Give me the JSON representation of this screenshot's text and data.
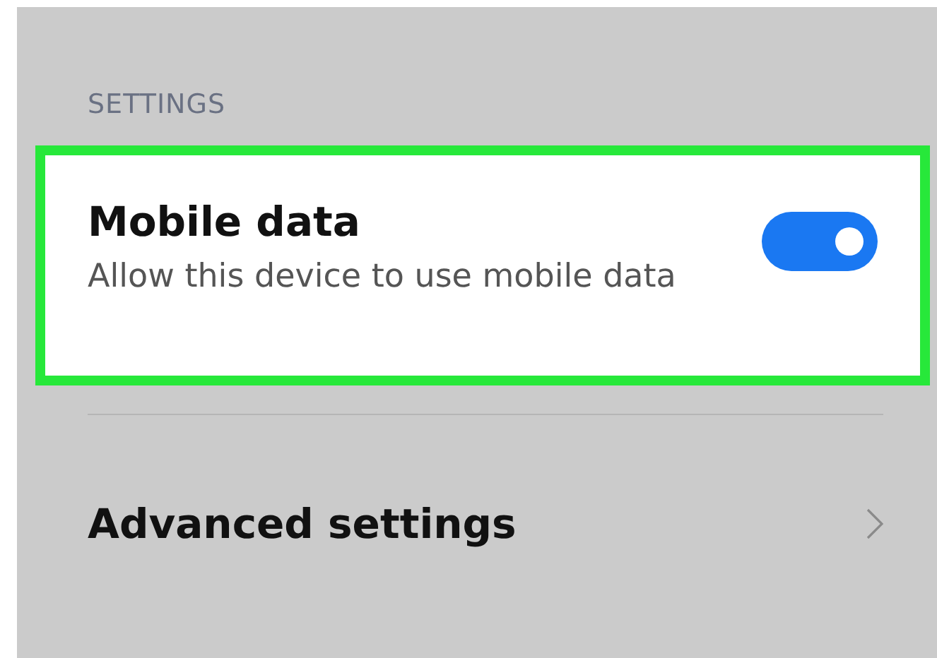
{
  "section_header": "SETTINGS",
  "settings": [
    {
      "kind": "toggle",
      "title": "Mobile data",
      "subtitle": "Allow this device to use mobile data",
      "on": true,
      "highlighted": true
    },
    {
      "kind": "link",
      "title": "Advanced settings",
      "highlighted": false
    }
  ]
}
